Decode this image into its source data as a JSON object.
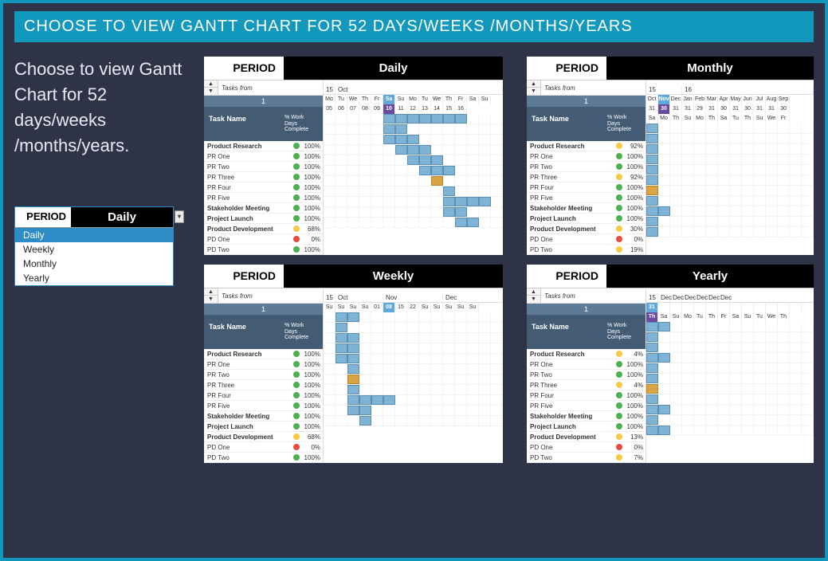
{
  "title": "CHOOSE TO VIEW GANTT CHART FOR 52 DAYS/WEEKS /MONTHS/YEARS",
  "intro": "Choose to view Gantt Chart for 52 days/weeks /months/years.",
  "dropdown": {
    "label": "PERIOD",
    "value": "Daily",
    "items": [
      "Daily",
      "Weekly",
      "Monthly",
      "Yearly"
    ]
  },
  "period_label": "PERIOD",
  "pct_header": "% Work Days Complete",
  "tasks_from": "Tasks from",
  "task_num": "1",
  "task_name_header": "Task Name",
  "tasks": [
    {
      "name": "Product Research",
      "bold": true,
      "status": "green",
      "pct": "100%"
    },
    {
      "name": "PR One",
      "bold": false,
      "status": "green",
      "pct": "100%"
    },
    {
      "name": "PR Two",
      "bold": false,
      "status": "green",
      "pct": "100%"
    },
    {
      "name": "PR Three",
      "bold": false,
      "status": "green",
      "pct": "100%"
    },
    {
      "name": "PR Four",
      "bold": false,
      "status": "green",
      "pct": "100%"
    },
    {
      "name": "PR Five",
      "bold": false,
      "status": "green",
      "pct": "100%"
    },
    {
      "name": "Stakeholder Meeting",
      "bold": true,
      "status": "green",
      "pct": "100%"
    },
    {
      "name": "Project Launch",
      "bold": true,
      "status": "green",
      "pct": "100%"
    },
    {
      "name": "Product Development",
      "bold": true,
      "status": "yellow",
      "pct": "68%"
    },
    {
      "name": "PD One",
      "bold": false,
      "status": "red",
      "pct": "0%"
    },
    {
      "name": "PD Two",
      "bold": false,
      "status": "green",
      "pct": "100%"
    }
  ],
  "charts": {
    "daily": {
      "value": "Daily",
      "h1": [
        {
          "label": "15",
          "span": 1
        },
        {
          "label": "Oct",
          "span": 14
        }
      ],
      "h2": [
        "Mo",
        "Tu",
        "We",
        "Th",
        "Fr",
        "Sa",
        "Su",
        "Mo",
        "Tu",
        "We",
        "Th",
        "Fr",
        "Sa",
        "Su"
      ],
      "h3": [
        "05",
        "06",
        "07",
        "08",
        "09",
        "10",
        "11",
        "12",
        "13",
        "14",
        "15",
        "16"
      ],
      "hl_idx": 5,
      "bars": [
        [
          0,
          0,
          0,
          0,
          0,
          1,
          1,
          1,
          1,
          1,
          1,
          1,
          0,
          0
        ],
        [
          0,
          0,
          0,
          0,
          0,
          1,
          1,
          0,
          0,
          0,
          0,
          0,
          0,
          0
        ],
        [
          0,
          0,
          0,
          0,
          0,
          1,
          1,
          1,
          0,
          0,
          0,
          0,
          0,
          0
        ],
        [
          0,
          0,
          0,
          0,
          0,
          0,
          1,
          1,
          1,
          0,
          0,
          0,
          0,
          0
        ],
        [
          0,
          0,
          0,
          0,
          0,
          0,
          0,
          1,
          1,
          1,
          0,
          0,
          0,
          0
        ],
        [
          0,
          0,
          0,
          0,
          0,
          0,
          0,
          0,
          1,
          1,
          1,
          0,
          0,
          0
        ],
        [
          0,
          0,
          0,
          0,
          0,
          0,
          0,
          0,
          0,
          2,
          0,
          0,
          0,
          0
        ],
        [
          0,
          0,
          0,
          0,
          0,
          0,
          0,
          0,
          0,
          0,
          1,
          0,
          0,
          0
        ],
        [
          0,
          0,
          0,
          0,
          0,
          0,
          0,
          0,
          0,
          0,
          1,
          1,
          1,
          1
        ],
        [
          0,
          0,
          0,
          0,
          0,
          0,
          0,
          0,
          0,
          0,
          1,
          1,
          0,
          0
        ],
        [
          0,
          0,
          0,
          0,
          0,
          0,
          0,
          0,
          0,
          0,
          0,
          1,
          1,
          0
        ]
      ]
    },
    "weekly": {
      "value": "Weekly",
      "h1": [
        {
          "label": "15",
          "span": 1
        },
        {
          "label": "Oct",
          "span": 4
        },
        {
          "label": "Nov",
          "span": 5
        },
        {
          "label": "Dec",
          "span": 5
        }
      ],
      "h2": [
        "Su",
        "Su",
        "Su",
        "Su",
        "01",
        "08",
        "15",
        "22",
        "Su",
        "Su",
        "Su",
        "Su",
        "Su"
      ],
      "h3": [],
      "hl_idx": 5,
      "bars": [
        [
          0,
          1,
          1,
          0,
          0,
          0,
          0,
          0,
          0,
          0,
          0,
          0,
          0,
          0
        ],
        [
          0,
          1,
          0,
          0,
          0,
          0,
          0,
          0,
          0,
          0,
          0,
          0,
          0,
          0
        ],
        [
          0,
          1,
          1,
          0,
          0,
          0,
          0,
          0,
          0,
          0,
          0,
          0,
          0,
          0
        ],
        [
          0,
          1,
          1,
          0,
          0,
          0,
          0,
          0,
          0,
          0,
          0,
          0,
          0,
          0
        ],
        [
          0,
          1,
          1,
          0,
          0,
          0,
          0,
          0,
          0,
          0,
          0,
          0,
          0,
          0
        ],
        [
          0,
          0,
          1,
          0,
          0,
          0,
          0,
          0,
          0,
          0,
          0,
          0,
          0,
          0
        ],
        [
          0,
          0,
          2,
          0,
          0,
          0,
          0,
          0,
          0,
          0,
          0,
          0,
          0,
          0
        ],
        [
          0,
          0,
          1,
          0,
          0,
          0,
          0,
          0,
          0,
          0,
          0,
          0,
          0,
          0
        ],
        [
          0,
          0,
          1,
          1,
          1,
          1,
          0,
          0,
          0,
          0,
          0,
          0,
          0,
          0
        ],
        [
          0,
          0,
          1,
          1,
          0,
          0,
          0,
          0,
          0,
          0,
          0,
          0,
          0,
          0
        ],
        [
          0,
          0,
          0,
          1,
          0,
          0,
          0,
          0,
          0,
          0,
          0,
          0,
          0,
          0
        ]
      ]
    },
    "monthly": {
      "value": "Monthly",
      "tasks_pct": [
        "92%",
        "100%",
        "100%",
        "92%",
        "100%",
        "100%",
        "100%",
        "100%",
        "30%",
        "0%",
        "19%"
      ],
      "tasks_status": [
        "yellow",
        "green",
        "green",
        "yellow",
        "green",
        "green",
        "green",
        "green",
        "yellow",
        "red",
        "yellow"
      ],
      "h1": [
        {
          "label": "15",
          "span": 3
        },
        {
          "label": "16",
          "span": 11
        }
      ],
      "h2": [
        "Oct",
        "Nov",
        "Dec",
        "Jan",
        "Feb",
        "Mar",
        "Apr",
        "May",
        "Jun",
        "Jul",
        "Aug",
        "Sep"
      ],
      "h3": [
        "31",
        "30",
        "31",
        "31",
        "29",
        "31",
        "30",
        "31",
        "30",
        "31",
        "31",
        "30"
      ],
      "h3_days": [
        "Sa",
        "Mo",
        "Th",
        "Su",
        "Mo",
        "Th",
        "Sa",
        "Tu",
        "Th",
        "Su",
        "We",
        "Fr"
      ],
      "hl_idx": 1,
      "bars": [
        [
          1,
          0,
          0,
          0,
          0,
          0,
          0,
          0,
          0,
          0,
          0,
          0,
          0,
          0
        ],
        [
          1,
          0,
          0,
          0,
          0,
          0,
          0,
          0,
          0,
          0,
          0,
          0,
          0,
          0
        ],
        [
          1,
          0,
          0,
          0,
          0,
          0,
          0,
          0,
          0,
          0,
          0,
          0,
          0,
          0
        ],
        [
          1,
          0,
          0,
          0,
          0,
          0,
          0,
          0,
          0,
          0,
          0,
          0,
          0,
          0
        ],
        [
          1,
          0,
          0,
          0,
          0,
          0,
          0,
          0,
          0,
          0,
          0,
          0,
          0,
          0
        ],
        [
          1,
          0,
          0,
          0,
          0,
          0,
          0,
          0,
          0,
          0,
          0,
          0,
          0,
          0
        ],
        [
          2,
          0,
          0,
          0,
          0,
          0,
          0,
          0,
          0,
          0,
          0,
          0,
          0,
          0
        ],
        [
          1,
          0,
          0,
          0,
          0,
          0,
          0,
          0,
          0,
          0,
          0,
          0,
          0,
          0
        ],
        [
          1,
          1,
          0,
          0,
          0,
          0,
          0,
          0,
          0,
          0,
          0,
          0,
          0,
          0
        ],
        [
          1,
          0,
          0,
          0,
          0,
          0,
          0,
          0,
          0,
          0,
          0,
          0,
          0,
          0
        ],
        [
          1,
          0,
          0,
          0,
          0,
          0,
          0,
          0,
          0,
          0,
          0,
          0,
          0,
          0
        ]
      ]
    },
    "yearly": {
      "value": "Yearly",
      "tasks_pct": [
        "4%",
        "100%",
        "100%",
        "4%",
        "100%",
        "100%",
        "100%",
        "100%",
        "13%",
        "0%",
        "7%"
      ],
      "tasks_status": [
        "yellow",
        "green",
        "green",
        "yellow",
        "green",
        "green",
        "green",
        "green",
        "yellow",
        "red",
        "yellow"
      ],
      "h1": [
        {
          "label": "15",
          "span": 1
        },
        {
          "label": "Dec",
          "span": 1
        },
        {
          "label": "Dec",
          "span": 1
        },
        {
          "label": "Dec",
          "span": 1
        },
        {
          "label": "Dec",
          "span": 1
        },
        {
          "label": "Dec",
          "span": 1
        },
        {
          "label": "Dec",
          "span": 1
        }
      ],
      "h2": [
        "31",
        "",
        "",
        "",
        "",
        "",
        "",
        "",
        "",
        "",
        "",
        "",
        ""
      ],
      "h3": [
        "Th",
        "Sa",
        "Su",
        "Mo",
        "Tu",
        "Th",
        "Fr",
        "Sa",
        "Su",
        "Tu",
        "We",
        "Th"
      ],
      "hl_idx": 0,
      "bars": [
        [
          1,
          1,
          0,
          0,
          0,
          0,
          0,
          0,
          0,
          0,
          0,
          0,
          0,
          0
        ],
        [
          1,
          0,
          0,
          0,
          0,
          0,
          0,
          0,
          0,
          0,
          0,
          0,
          0,
          0
        ],
        [
          1,
          0,
          0,
          0,
          0,
          0,
          0,
          0,
          0,
          0,
          0,
          0,
          0,
          0
        ],
        [
          1,
          1,
          0,
          0,
          0,
          0,
          0,
          0,
          0,
          0,
          0,
          0,
          0,
          0
        ],
        [
          1,
          0,
          0,
          0,
          0,
          0,
          0,
          0,
          0,
          0,
          0,
          0,
          0,
          0
        ],
        [
          1,
          0,
          0,
          0,
          0,
          0,
          0,
          0,
          0,
          0,
          0,
          0,
          0,
          0
        ],
        [
          2,
          0,
          0,
          0,
          0,
          0,
          0,
          0,
          0,
          0,
          0,
          0,
          0,
          0
        ],
        [
          1,
          0,
          0,
          0,
          0,
          0,
          0,
          0,
          0,
          0,
          0,
          0,
          0,
          0
        ],
        [
          1,
          1,
          0,
          0,
          0,
          0,
          0,
          0,
          0,
          0,
          0,
          0,
          0,
          0
        ],
        [
          1,
          0,
          0,
          0,
          0,
          0,
          0,
          0,
          0,
          0,
          0,
          0,
          0,
          0
        ],
        [
          1,
          1,
          0,
          0,
          0,
          0,
          0,
          0,
          0,
          0,
          0,
          0,
          0,
          0
        ]
      ]
    }
  }
}
